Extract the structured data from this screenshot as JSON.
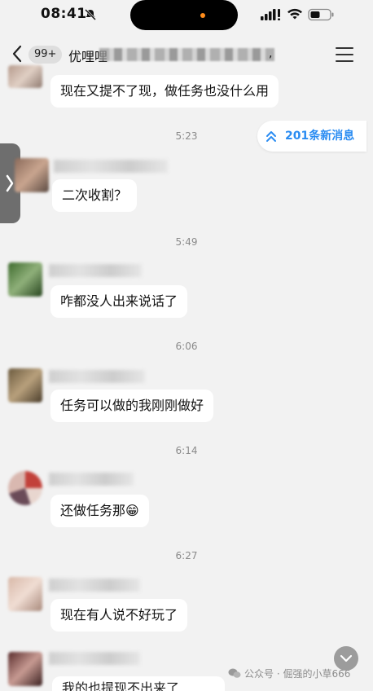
{
  "status_bar": {
    "time": "08:41"
  },
  "nav": {
    "badge": "99+",
    "title": "优哩哩",
    "title_suffix": ","
  },
  "new_messages": {
    "label": "201条新消息"
  },
  "messages": [
    {
      "text": "现在又提不了现，做任务也没什么用"
    },
    {
      "time": "5:23"
    },
    {
      "text": "二次收割？"
    },
    {
      "time": "5:49"
    },
    {
      "text": "咋都没人出来说话了"
    },
    {
      "time": "6:06"
    },
    {
      "text": "任务可以做的我刚刚做好"
    },
    {
      "time": "6:14"
    },
    {
      "text": "还做任务那😁"
    },
    {
      "time": "6:27"
    },
    {
      "text": "现在有人说不好玩了"
    },
    {
      "text": "我的也提现不出来了"
    }
  ],
  "watermark": {
    "text": "公众号 · 倔强的小草666"
  },
  "colors": {
    "accent": "#2a8cf2",
    "bubble": "#ffffff",
    "background": "#f2f2f2"
  }
}
